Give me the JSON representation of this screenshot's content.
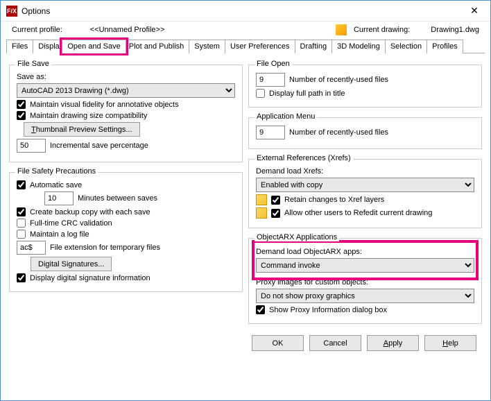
{
  "window": {
    "title": "Options"
  },
  "profile": {
    "label": "Current profile:",
    "value": "<<Unnamed Profile>>",
    "drawing_label": "Current drawing:",
    "drawing_value": "Drawing1.dwg"
  },
  "tabs": [
    "Files",
    "Display",
    "Open and Save",
    "Plot and Publish",
    "System",
    "User Preferences",
    "Drafting",
    "3D Modeling",
    "Selection",
    "Profiles"
  ],
  "file_save": {
    "group": "File Save",
    "save_as_label": "Save as:",
    "save_as_value": "AutoCAD 2013 Drawing (*.dwg)",
    "maintain_visual": "Maintain visual fidelity for annotative objects",
    "maintain_size": "Maintain drawing size compatibility",
    "thumbnail_btn": "Thumbnail Preview Settings...",
    "incr_value": "50",
    "incr_label": "Incremental save percentage"
  },
  "file_safety": {
    "group": "File Safety Precautions",
    "auto_save": "Automatic save",
    "minutes_value": "10",
    "minutes_label": "Minutes between saves",
    "backup": "Create backup copy with each save",
    "crc": "Full-time CRC validation",
    "log": "Maintain a log file",
    "ext_value": "ac$",
    "ext_label": "File extension for temporary files",
    "digital_sig_btn": "Digital Signatures...",
    "display_sig": "Display digital signature information"
  },
  "file_open": {
    "group": "File Open",
    "recent_value": "9",
    "recent_label": "Number of recently-used files",
    "full_path": "Display full path in title"
  },
  "app_menu": {
    "group": "Application Menu",
    "recent_value": "9",
    "recent_label": "Number of recently-used files"
  },
  "xrefs": {
    "group": "External References (Xrefs)",
    "demand_label": "Demand load Xrefs:",
    "demand_value": "Enabled with copy",
    "retain": "Retain changes to Xref layers",
    "allow_refedit": "Allow other users to Refedit current drawing"
  },
  "arx": {
    "group": "ObjectARX Applications",
    "demand_label": "Demand load ObjectARX apps:",
    "demand_value": "Command invoke",
    "proxy_label": "Proxy images for custom objects:",
    "proxy_value": "Do not show proxy graphics",
    "show_proxy": "Show Proxy Information dialog box"
  },
  "buttons": {
    "ok": "OK",
    "cancel": "Cancel",
    "apply": "Apply",
    "help": "Help"
  }
}
